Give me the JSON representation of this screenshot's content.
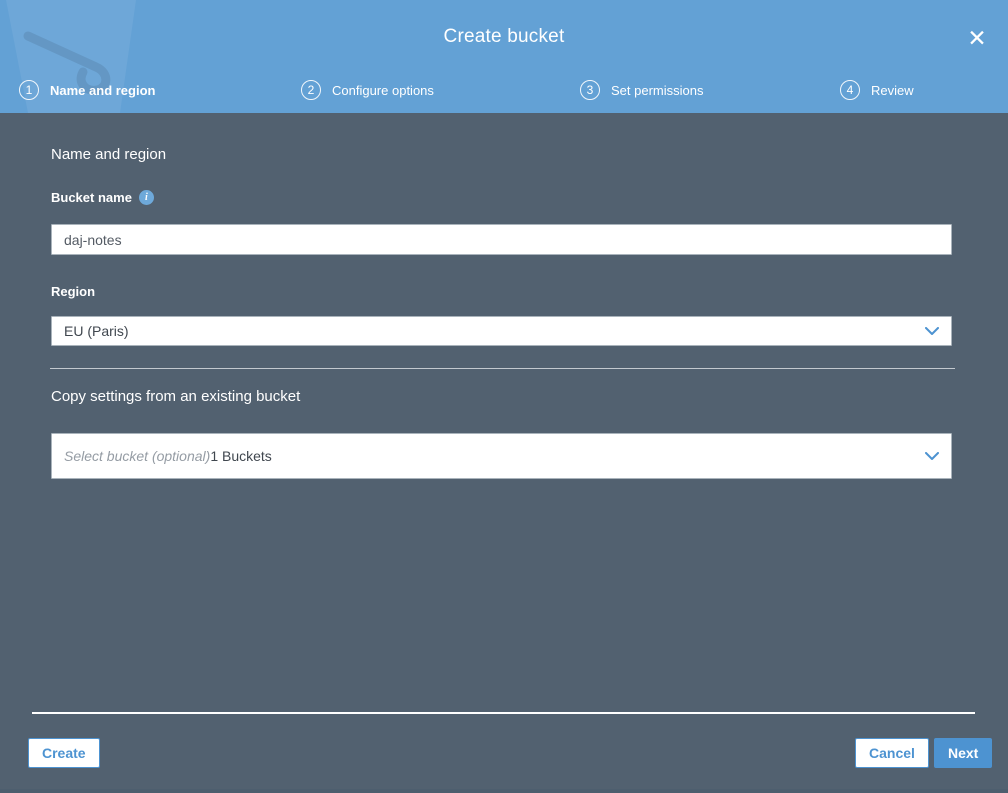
{
  "modal": {
    "title": "Create bucket",
    "close_icon": "✕"
  },
  "steps": [
    {
      "number": "1",
      "label": "Name and region",
      "active": true
    },
    {
      "number": "2",
      "label": "Configure options",
      "active": false
    },
    {
      "number": "3",
      "label": "Set permissions",
      "active": false
    },
    {
      "number": "4",
      "label": "Review",
      "active": false
    }
  ],
  "form": {
    "section_heading": "Name and region",
    "bucket_name": {
      "label": "Bucket name",
      "info_icon": "i",
      "value": "daj-notes"
    },
    "region": {
      "label": "Region",
      "selected": "EU (Paris)"
    },
    "copy_settings": {
      "heading": "Copy settings from an existing bucket",
      "placeholder": "Select bucket (optional)",
      "suffix": "1 Buckets"
    }
  },
  "footer": {
    "create_label": "Create",
    "cancel_label": "Cancel",
    "next_label": "Next"
  },
  "colors": {
    "header_blue": "#63a1d5",
    "content_slate": "#526170",
    "accent_blue": "#4d93d1"
  }
}
